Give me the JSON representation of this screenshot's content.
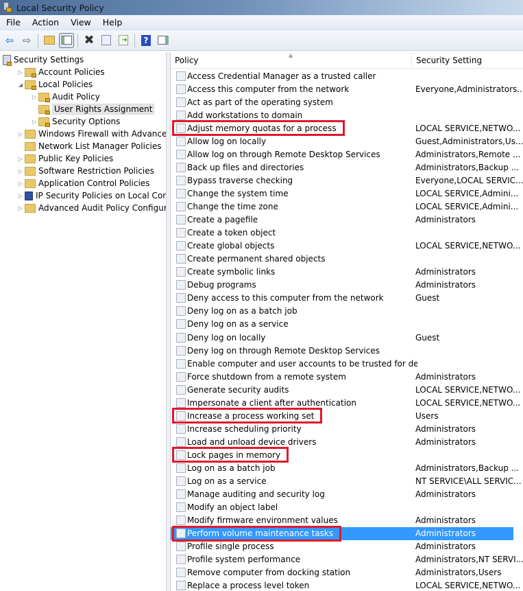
{
  "window": {
    "title": "Local Security Policy"
  },
  "menu": [
    "File",
    "Action",
    "View",
    "Help"
  ],
  "toolbar": {
    "icons": [
      "back-icon",
      "forward-icon",
      "up-folder-icon",
      "show-hide-tree-icon",
      "delete-icon",
      "properties-icon",
      "export-list-icon",
      "help-icon",
      "show-action-pane-icon"
    ]
  },
  "tree": [
    {
      "label": "Security Settings",
      "level": 0,
      "arrow": "",
      "icon": "server-lock"
    },
    {
      "label": "Account Policies",
      "level": 1,
      "arrow": "▷",
      "icon": "folder-lock"
    },
    {
      "label": "Local Policies",
      "level": 1,
      "arrow": "◢",
      "icon": "folder-lock"
    },
    {
      "label": "Audit Policy",
      "level": 2,
      "arrow": "▷",
      "icon": "folder-lock"
    },
    {
      "label": "User Rights Assignment",
      "level": 2,
      "arrow": "",
      "icon": "folder-lock",
      "selected": true
    },
    {
      "label": "Security Options",
      "level": 2,
      "arrow": "▷",
      "icon": "folder-lock"
    },
    {
      "label": "Windows Firewall with Advanced Secu",
      "level": 1,
      "arrow": "▷",
      "icon": "folder"
    },
    {
      "label": "Network List Manager Policies",
      "level": 1,
      "arrow": "",
      "icon": "folder"
    },
    {
      "label": "Public Key Policies",
      "level": 1,
      "arrow": "▷",
      "icon": "folder"
    },
    {
      "label": "Software Restriction Policies",
      "level": 1,
      "arrow": "▷",
      "icon": "folder"
    },
    {
      "label": "Application Control Policies",
      "level": 1,
      "arrow": "▷",
      "icon": "folder"
    },
    {
      "label": "IP Security Policies on Local Compute",
      "level": 1,
      "arrow": "▷",
      "icon": "shield"
    },
    {
      "label": "Advanced Audit Policy Configuration",
      "level": 1,
      "arrow": "▷",
      "icon": "folder"
    }
  ],
  "list": {
    "columns": [
      "Policy",
      "Security Setting"
    ],
    "rows": [
      {
        "policy": "Access Credential Manager as a trusted caller",
        "setting": ""
      },
      {
        "policy": "Access this computer from the network",
        "setting": "Everyone,Administrators..."
      },
      {
        "policy": "Act as part of the operating system",
        "setting": ""
      },
      {
        "policy": "Add workstations to domain",
        "setting": ""
      },
      {
        "policy": "Adjust memory quotas for a process",
        "setting": "LOCAL SERVICE,NETWO...",
        "highlight": true
      },
      {
        "policy": "Allow log on locally",
        "setting": "Guest,Administrators,Us..."
      },
      {
        "policy": "Allow log on through Remote Desktop Services",
        "setting": "Administrators,Remote ..."
      },
      {
        "policy": "Back up files and directories",
        "setting": "Administrators,Backup ..."
      },
      {
        "policy": "Bypass traverse checking",
        "setting": "Everyone,LOCAL SERVIC..."
      },
      {
        "policy": "Change the system time",
        "setting": "LOCAL SERVICE,Admini..."
      },
      {
        "policy": "Change the time zone",
        "setting": "LOCAL SERVICE,Admini..."
      },
      {
        "policy": "Create a pagefile",
        "setting": "Administrators"
      },
      {
        "policy": "Create a token object",
        "setting": ""
      },
      {
        "policy": "Create global objects",
        "setting": "LOCAL SERVICE,NETWO..."
      },
      {
        "policy": "Create permanent shared objects",
        "setting": ""
      },
      {
        "policy": "Create symbolic links",
        "setting": "Administrators"
      },
      {
        "policy": "Debug programs",
        "setting": "Administrators"
      },
      {
        "policy": "Deny access to this computer from the network",
        "setting": "Guest"
      },
      {
        "policy": "Deny log on as a batch job",
        "setting": ""
      },
      {
        "policy": "Deny log on as a service",
        "setting": ""
      },
      {
        "policy": "Deny log on locally",
        "setting": "Guest"
      },
      {
        "policy": "Deny log on through Remote Desktop Services",
        "setting": ""
      },
      {
        "policy": "Enable computer and user accounts to be trusted for delega...",
        "setting": ""
      },
      {
        "policy": "Force shutdown from a remote system",
        "setting": "Administrators"
      },
      {
        "policy": "Generate security audits",
        "setting": "LOCAL SERVICE,NETWO..."
      },
      {
        "policy": "Impersonate a client after authentication",
        "setting": "LOCAL SERVICE,NETWO..."
      },
      {
        "policy": "Increase a process working set",
        "setting": "Users",
        "highlight": true
      },
      {
        "policy": "Increase scheduling priority",
        "setting": "Administrators"
      },
      {
        "policy": "Load and unload device drivers",
        "setting": "Administrators"
      },
      {
        "policy": "Lock pages in memory",
        "setting": "",
        "highlight": true
      },
      {
        "policy": "Log on as a batch job",
        "setting": "Administrators,Backup ..."
      },
      {
        "policy": "Log on as a service",
        "setting": "NT SERVICE\\ALL SERVIC..."
      },
      {
        "policy": "Manage auditing and security log",
        "setting": "Administrators"
      },
      {
        "policy": "Modify an object label",
        "setting": ""
      },
      {
        "policy": "Modify firmware environment values",
        "setting": "Administrators"
      },
      {
        "policy": "Perform volume maintenance tasks",
        "setting": "Administrators",
        "highlight": true,
        "selected": true
      },
      {
        "policy": "Profile single process",
        "setting": "Administrators"
      },
      {
        "policy": "Profile system performance",
        "setting": "Administrators,NT SERVI..."
      },
      {
        "policy": "Remove computer from docking station",
        "setting": "Administrators,Users"
      },
      {
        "policy": "Replace a process level token",
        "setting": "LOCAL SERVICE,NETWO..."
      }
    ]
  },
  "colors": {
    "highlight_box": "#e0192a",
    "selection": "#3399ff"
  }
}
